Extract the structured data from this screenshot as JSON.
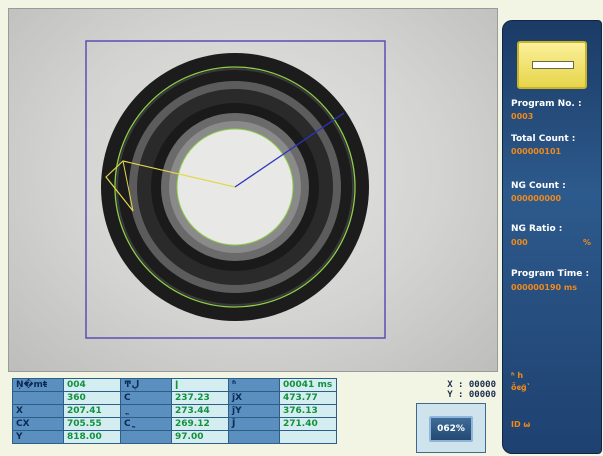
{
  "viewport": {
    "colors": {
      "roi": "#5b4fb5",
      "fit_circle": "#8fcf4a",
      "yellow_line": "#e3d84a",
      "blue_line": "#2c33b8"
    }
  },
  "table": {
    "rows": [
      [
        "Ņ�mŧ",
        "004",
        "ͳڸ",
        "ǀ",
        "ʱ",
        "00041 ms"
      ],
      [
        "",
        "360",
        "С",
        "237.23",
        "ĵX",
        "473.77"
      ],
      [
        "X",
        "207.41",
        "ֱ",
        "273.44",
        "ĵY",
        "376.13"
      ],
      [
        "СX",
        "705.55",
        "Сֱ",
        "269.12",
        "Ĵ",
        "271.40"
      ],
      [
        "Y",
        "818.00",
        "",
        "97.00",
        "",
        ""
      ]
    ]
  },
  "readout": {
    "x": "X : 00000",
    "y": "Y : 00000"
  },
  "zoom": {
    "label": "062%"
  },
  "sidebar": {
    "program_no_label": "Program No. :",
    "program_no_value": "0003",
    "total_count_label": "Total Count :",
    "total_count_value": "000000101",
    "ng_count_label": "NG Count :",
    "ng_count_value": "000000000",
    "ng_ratio_label": "NG Ratio :",
    "ng_ratio_value": "000",
    "ng_ratio_unit": "%",
    "program_time_label": "Program Time :",
    "program_time_value": "000000190 ms",
    "note_line1": "ʱ һ",
    "note_line2": "ȫͼģʽ",
    "note_line3": "ID  ѡ",
    "status_color": "#efe06a"
  }
}
